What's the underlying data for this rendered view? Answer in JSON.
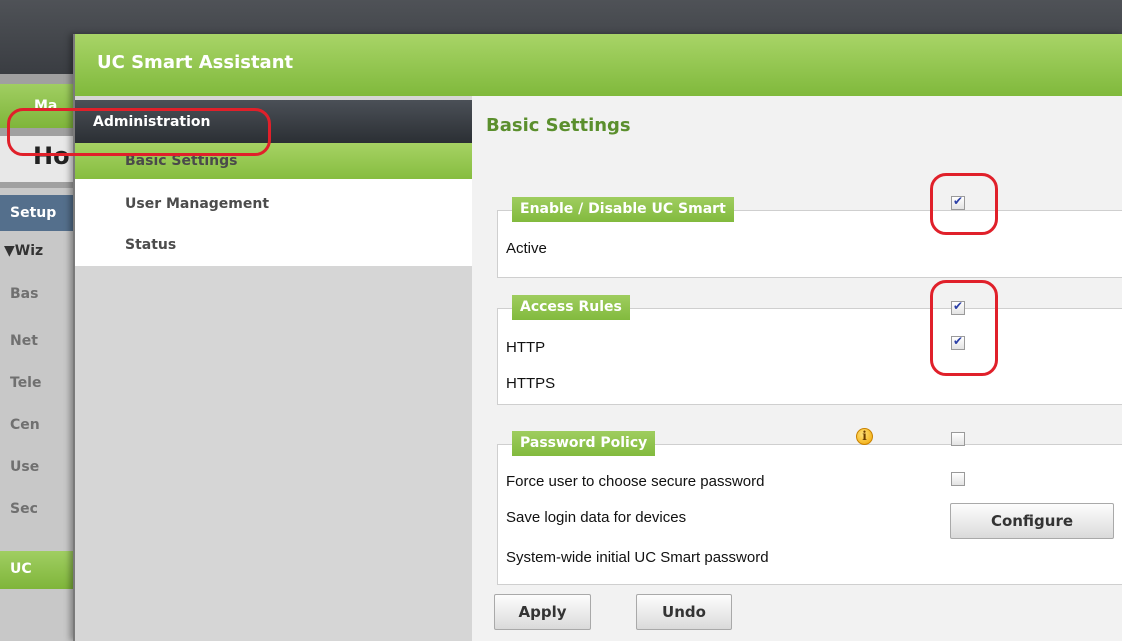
{
  "background_app": {
    "tab_label": "Ma",
    "home_title": "Ho",
    "setup_label": "Setup",
    "wizard_label": "▼Wiz",
    "items": [
      "Bas",
      "Net",
      "Tele",
      "Cen",
      "Use",
      "Sec"
    ],
    "active_item": "UC"
  },
  "dialog": {
    "title": "UC Smart Assistant"
  },
  "nav": {
    "header": "Administration",
    "items": [
      {
        "label": "Basic Settings",
        "selected": true
      },
      {
        "label": "User Management",
        "selected": false
      },
      {
        "label": "Status",
        "selected": false
      }
    ]
  },
  "content": {
    "page_title": "Basic Settings",
    "enable_group": {
      "title": "Enable / Disable UC Smart",
      "active_label": "Active",
      "active_checked": true
    },
    "access_group": {
      "title": "Access Rules",
      "http_label": "HTTP",
      "http_checked": true,
      "https_label": "HTTPS",
      "https_checked": true
    },
    "password_group": {
      "title": "Password Policy",
      "force_label": "Force user to choose secure password",
      "force_checked": false,
      "save_label": "Save login data for devices",
      "save_checked": false,
      "initial_label": "System-wide initial UC Smart password",
      "configure_label": "Configure",
      "info_icon": "info-icon"
    },
    "apply_label": "Apply",
    "undo_label": "Undo"
  },
  "colors": {
    "accent_green": "#8cc34a",
    "title_green": "#5b8f2d",
    "highlight_red": "#e0202a",
    "nav_header_dark": "#2b2f34"
  }
}
